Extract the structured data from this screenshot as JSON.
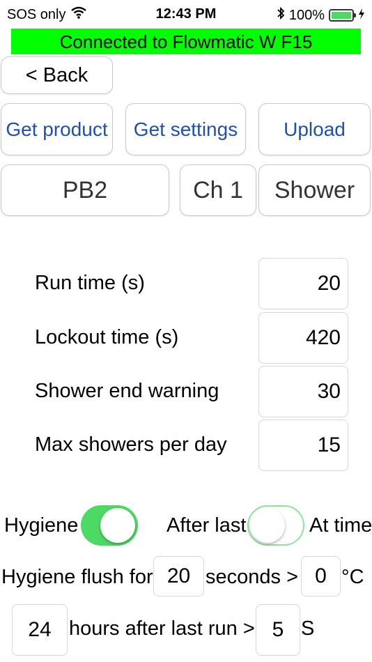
{
  "status_bar": {
    "carrier": "SOS only",
    "time": "12:43 PM",
    "battery_percent": "100%",
    "battery_level": 1.0,
    "icons": [
      "wifi-icon",
      "bluetooth-icon",
      "battery-icon",
      "charging-bolt-icon"
    ]
  },
  "connection_banner": {
    "text": "Connected to Flowmatic W F15",
    "color": "#00ff00"
  },
  "nav": {
    "back_label": "< Back"
  },
  "actions": {
    "get_product": "Get product",
    "get_settings": "Get settings",
    "upload": "Upload",
    "accent_color": "#1e50b4"
  },
  "selectors": {
    "product": "PB2",
    "channel": "Ch 1",
    "mode": "Shower"
  },
  "settings": [
    {
      "label": "Run time (s)",
      "value": "20"
    },
    {
      "label": "Lockout time (s)",
      "value": "420"
    },
    {
      "label": "Shower end warning",
      "value": "30"
    },
    {
      "label": "Max  showers per day",
      "value": "15"
    }
  ],
  "hygiene": {
    "label": "Hygiene",
    "enabled": true,
    "after_last_label": "After last",
    "at_time_label": "At time",
    "timing_switch_on": false,
    "toggle_on_color": "#4cd964",
    "flush_prefix": "Hygiene flush for",
    "flush_seconds": "20",
    "seconds_label": "seconds >",
    "temperature": "0",
    "temp_unit": "°C",
    "hours_after": "24",
    "hours_label": "hours after last run >",
    "seconds_value": "5",
    "seconds_unit": "S"
  }
}
